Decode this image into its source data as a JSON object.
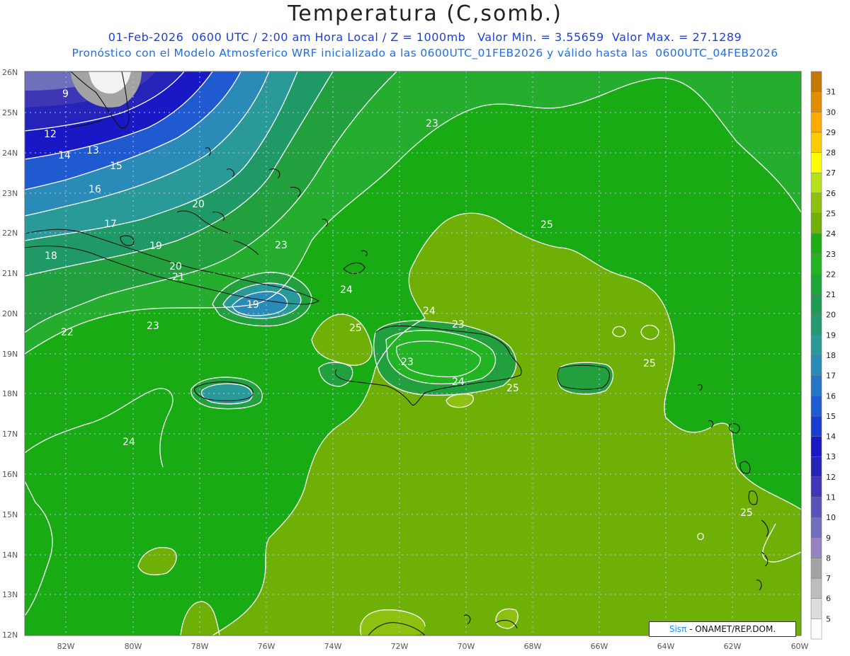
{
  "header": {
    "title": "Temperatura (C,somb.)",
    "line1": "01-Feb-2026  0600 UTC / 2:00 am Hora Local / Z = 1000mb   Valor Min. = 3.55659  Valor Max. = 27.1289",
    "line2": "Pronóstico con el Modelo Atmosferico WRF inicializado a las 0600UTC_01FEB2026 y válido hasta las  0600UTC_04FEB2026"
  },
  "axes": {
    "lat_labels": [
      "26N",
      "25N",
      "24N",
      "23N",
      "22N",
      "21N",
      "20N",
      "19N",
      "18N",
      "17N",
      "16N",
      "15N",
      "14N",
      "13N",
      "12N"
    ],
    "lon_labels": [
      "82W",
      "80W",
      "78W",
      "76W",
      "74W",
      "72W",
      "70W",
      "68W",
      "66W",
      "64W",
      "62W",
      "60W"
    ]
  },
  "colorbar": {
    "labels": [
      "5",
      "6",
      "7",
      "8",
      "9",
      "10",
      "11",
      "12",
      "13",
      "14",
      "15",
      "16",
      "17",
      "18",
      "19",
      "20",
      "21",
      "22",
      "23",
      "24",
      "25",
      "26",
      "27",
      "28",
      "29",
      "30",
      "31"
    ],
    "colors": [
      "#ffffff",
      "#dcdcdc",
      "#bdbdbd",
      "#a3a3a3",
      "#9383c0",
      "#6f6fbc",
      "#5a52b8",
      "#3e36b5",
      "#2424b8",
      "#1818c4",
      "#1a3cd0",
      "#1f5ad0",
      "#2674c8",
      "#2a8ab8",
      "#2a9a98",
      "#239a72",
      "#209a54",
      "#20a538",
      "#22b422",
      "#1cae12",
      "#6fb007",
      "#8cc10f",
      "#b7e219",
      "#ffff00",
      "#ffcc00",
      "#ffaa00",
      "#e08e00",
      "#c47a00"
    ]
  },
  "contour_labels": [
    "9",
    "12",
    "13",
    "14",
    "15",
    "16",
    "17",
    "18",
    "19",
    "20",
    "21",
    "22",
    "23",
    "24",
    "25",
    "20",
    "23",
    "24",
    "25",
    "23",
    "23",
    "24",
    "24",
    "25",
    "25",
    "19",
    "25",
    "23",
    "24",
    "25"
  ],
  "credit": {
    "sis": "Sisπ",
    "text": " - ONAMET/REP.DOM."
  }
}
